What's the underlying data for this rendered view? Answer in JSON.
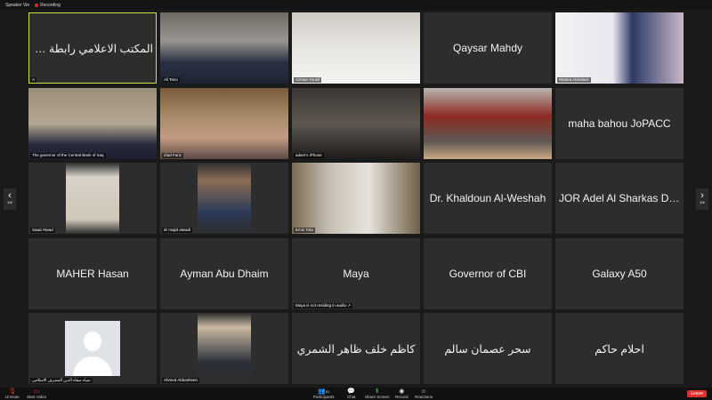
{
  "topbar": {
    "view_label": "Speaker Vie",
    "recording_label": "Recording"
  },
  "tiles": [
    {
      "name": "المكتب الاعلامي رابطة المصارف",
      "caption": "A",
      "rtl": true,
      "active": true
    },
    {
      "name": "",
      "caption": "Ali Tario"
    },
    {
      "name": "",
      "caption": "Azman Yousif"
    },
    {
      "name": "Qaysar Mahdy",
      "caption": ""
    },
    {
      "name": "",
      "caption": "Wadea Abhalack"
    },
    {
      "name": "",
      "caption": "The governor of the Central Bank of Iraq"
    },
    {
      "name": "",
      "caption": "Ziad Fariz"
    },
    {
      "name": "",
      "caption": "adam's iPhone"
    },
    {
      "name": "",
      "caption": ""
    },
    {
      "name": "maha bahou JoPACC",
      "caption": ""
    },
    {
      "name": "",
      "caption": "Saad Alwad"
    },
    {
      "name": "",
      "caption": "dr majid alwadi"
    },
    {
      "name": "",
      "caption": "Emin Tota"
    },
    {
      "name": "Dr. Khaldoun Al-Weshah",
      "caption": ""
    },
    {
      "name": "JOR Adel Al Sharkas Deputy...",
      "caption": ""
    },
    {
      "name": "MAHER Hasan",
      "caption": ""
    },
    {
      "name": "Ayman Abu Dhaim",
      "caption": ""
    },
    {
      "name": "Maya",
      "caption": "Maya is not residing in audio ↗"
    },
    {
      "name": "Governor of CBI",
      "caption": ""
    },
    {
      "name": "Galaxy A50",
      "caption": ""
    },
    {
      "name": "",
      "caption": "ضياء صفاء الدين المصرف الاسلامي"
    },
    {
      "name": "",
      "caption": "Ahmed Abbasheen"
    },
    {
      "name": "كاظم خلف ظاهر الشمري",
      "caption": "",
      "rtl": true
    },
    {
      "name": "سحر عصمان سالم",
      "caption": "",
      "rtl": true
    },
    {
      "name": "احلام حاكم",
      "caption": "",
      "rtl": true
    }
  ],
  "nav": {
    "left_page": "1/4",
    "right_page": "1/4"
  },
  "bottombar": {
    "unmute": "Unmute",
    "start_video": "Start Video",
    "participants": "Participants",
    "participants_count": "81",
    "chat": "Chat",
    "share_screen": "Share Screen",
    "record": "Record",
    "reactions": "Reactions",
    "leave": "Leave"
  },
  "colors": {
    "active_border": "#c8e64a",
    "leave": "#e0312d",
    "share": "#2ea94b"
  }
}
